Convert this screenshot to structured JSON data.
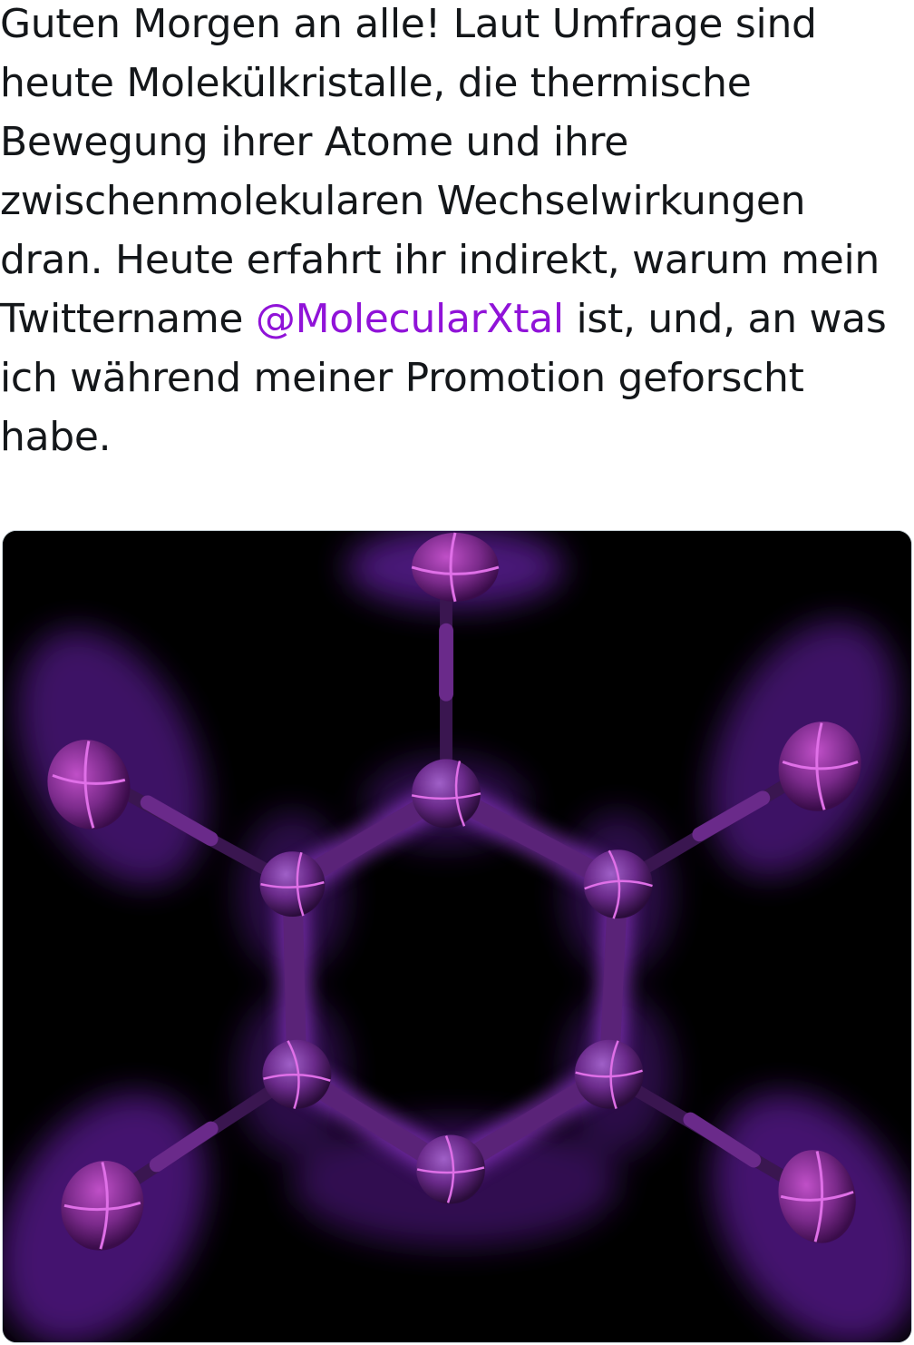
{
  "tweet": {
    "text_before": "Guten Morgen an alle! Laut Umfrage sind heute Molekülkristalle, die thermische Bewegung ihrer Atome und ihre zwischenmolekularen Wechselwirkungen dran. Heute erfahrt ihr indirekt, warum mein Twittername ",
    "mention": "@MolecularXtal",
    "text_after": " ist, und, an was ich während meiner Promotion geforscht habe."
  },
  "media": {
    "subject": "molecule-ring-render",
    "colors": {
      "background": "#000000",
      "glow": "#8a2be2",
      "atom": "#6a2a8a",
      "bond": "#5a2378",
      "accent": "#e070e8"
    }
  }
}
